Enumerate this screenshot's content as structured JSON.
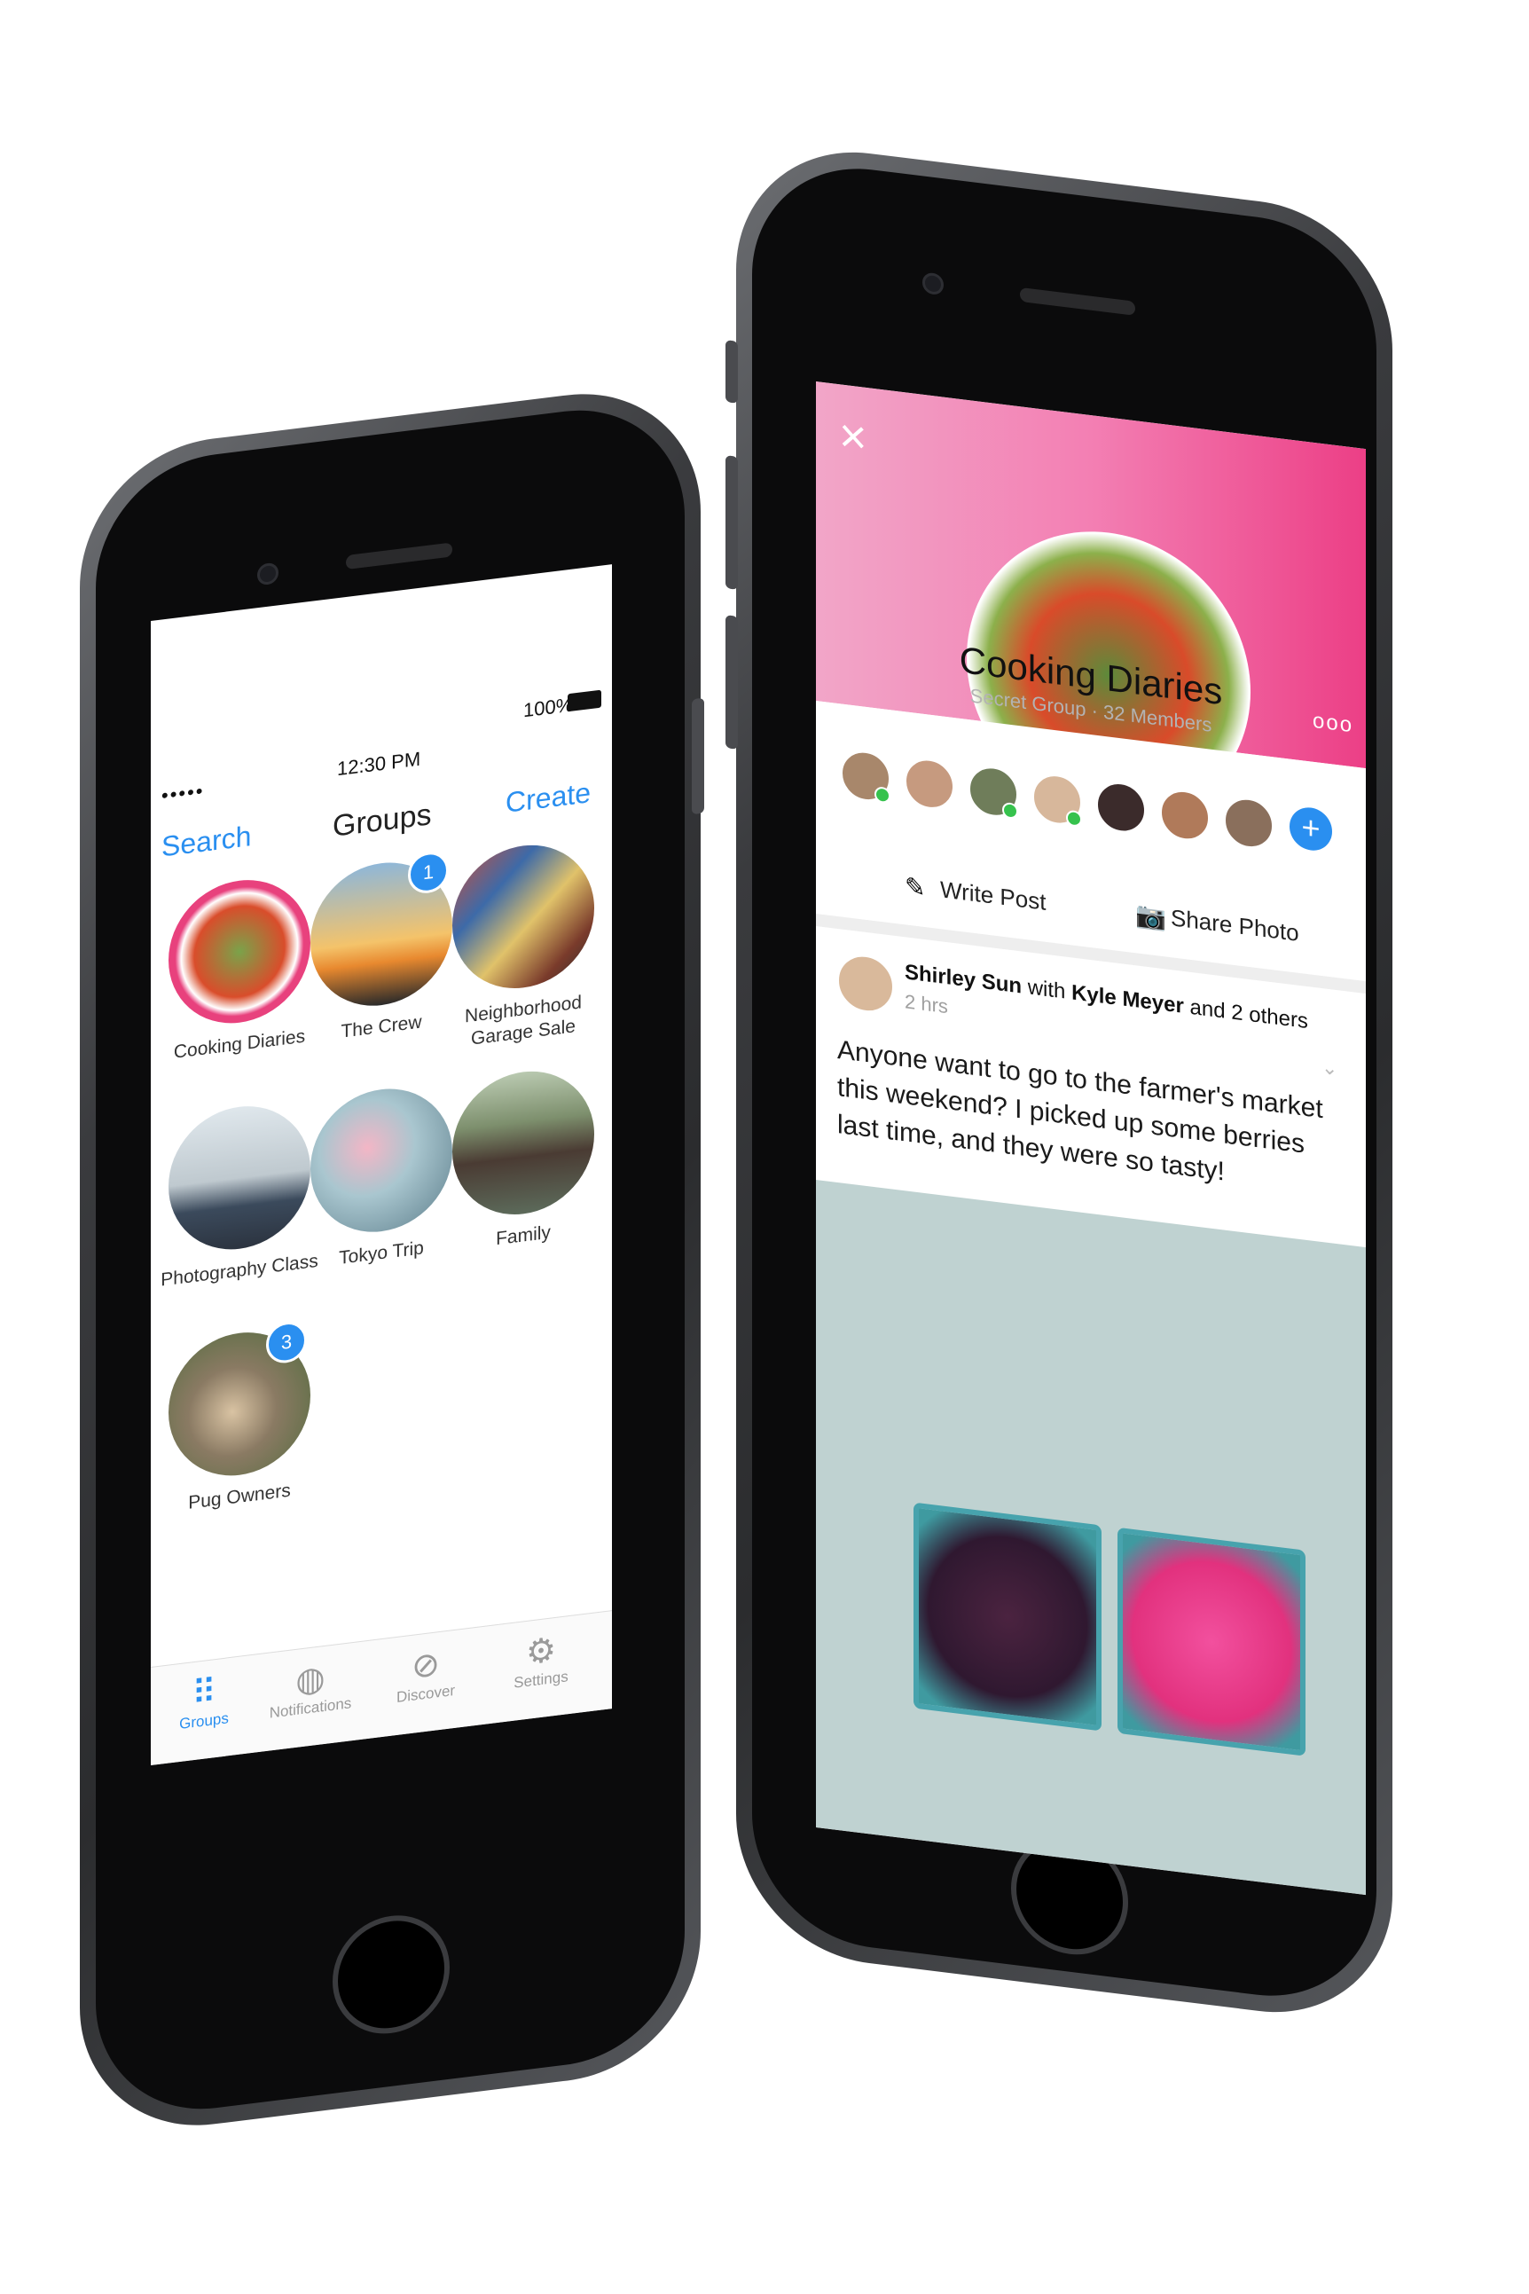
{
  "left_phone": {
    "status": {
      "time": "12:30 PM",
      "battery": "100%",
      "signal": "•••••"
    },
    "nav": {
      "title": "Groups",
      "left": "Search",
      "right": "Create"
    },
    "groups": [
      {
        "label": "Cooking Diaries",
        "badge": ""
      },
      {
        "label": "The Crew",
        "badge": "1"
      },
      {
        "label": "Neighborhood Garage Sale",
        "badge": ""
      },
      {
        "label": "Photography Class",
        "badge": ""
      },
      {
        "label": "Tokyo Trip",
        "badge": ""
      },
      {
        "label": "Family",
        "badge": ""
      },
      {
        "label": "Pug Owners",
        "badge": "3"
      }
    ],
    "tabs": [
      {
        "label": "Groups",
        "icon": "grid-icon"
      },
      {
        "label": "Notifications",
        "icon": "globe-icon"
      },
      {
        "label": "Discover",
        "icon": "compass-icon"
      },
      {
        "label": "Settings",
        "icon": "gear-icon"
      }
    ],
    "accent": "#2a8ff0"
  },
  "right_phone": {
    "group": {
      "title": "Cooking Diaries",
      "subtitle": "Secret Group · 32 Members"
    },
    "actions": {
      "write": "Write Post",
      "share": "Share Photo",
      "add": "+"
    },
    "post": {
      "author": "Shirley Sun",
      "with_text": "with",
      "tagged": "Kyle Meyer",
      "others": "and 2 others",
      "time": "2 hrs",
      "body": "Anyone want to go to the farmer's market this weekend? I picked up some berries last time, and they were so tasty!"
    },
    "close": "×",
    "more": "ooo",
    "accent": "#ec3f86"
  }
}
